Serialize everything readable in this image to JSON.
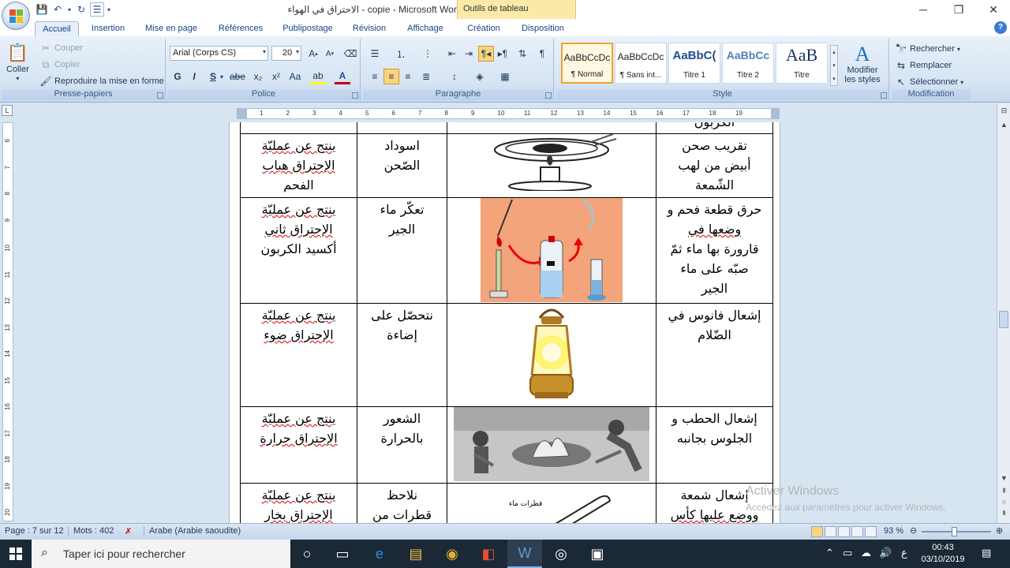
{
  "window": {
    "title": "الاحتراق في الهواء - copie - Microsoft Word",
    "contextual_tab": "Outils de tableau",
    "controls": {
      "minimize": "─",
      "maximize": "❐",
      "close": "✕"
    }
  },
  "tabs": [
    "Accueil",
    "Insertion",
    "Mise en page",
    "Références",
    "Publipostage",
    "Révision",
    "Affichage",
    "Création",
    "Disposition"
  ],
  "ribbon": {
    "clipboard": {
      "label": "Presse-papiers",
      "paste": "Coller",
      "cut": "Couper",
      "copy": "Copier",
      "format_painter": "Reproduire la mise en forme"
    },
    "font": {
      "label": "Police",
      "font_name": "Arial (Corps CS)",
      "font_size": "20",
      "bold": "G",
      "italic": "I",
      "underline": "S",
      "strike": "abe",
      "subscript": "x₂",
      "superscript": "x²",
      "change_case": "Aa",
      "highlight": "ab",
      "color": "A"
    },
    "paragraph": {
      "label": "Paragraphe"
    },
    "styles": {
      "label": "Style",
      "items": [
        {
          "preview": "AaBbCcDc",
          "name": "¶ Normal"
        },
        {
          "preview": "AaBbCcDc",
          "name": "¶ Sans int..."
        },
        {
          "preview": "AaBbC(",
          "name": "Titre 1"
        },
        {
          "preview": "AaBbCc",
          "name": "Titre 2"
        },
        {
          "preview": "AaB",
          "name": "Titre"
        }
      ],
      "change": "Modifier les styles"
    },
    "editing": {
      "label": "Modification",
      "find": "Rechercher",
      "replace": "Remplacer",
      "select": "Sélectionner"
    }
  },
  "ruler": {
    "ticks": [
      "1",
      "2",
      "3",
      "4",
      "5",
      "6",
      "7",
      "8",
      "9",
      "10",
      "11",
      "12",
      "13",
      "14",
      "15",
      "16",
      "17",
      "18",
      "19"
    ],
    "vticks": [
      "6",
      "7",
      "8",
      "9",
      "10",
      "11",
      "12",
      "13",
      "14",
      "15",
      "16",
      "17",
      "18",
      "19",
      "20"
    ]
  },
  "table": {
    "top_fragment": "الكربون",
    "rows": [
      {
        "experiment": [
          "تقريب صحن",
          "أبيض من لهب",
          "الشّمعة"
        ],
        "observation": [
          "اسوداد",
          "الصّحن"
        ],
        "conclusion": [
          "ينتج عن عمليّة",
          "الإحتراق هباب",
          "الفحم"
        ]
      },
      {
        "experiment": [
          "حرق قطعة فحم و",
          "وضعها في",
          "قارورة بها ماء ثمّ",
          "صبّه على ماء",
          "الجير"
        ],
        "observation": [
          "تعكّر ماء",
          "الجير"
        ],
        "conclusion": [
          "ينتج عن عمليّة",
          "الإحتراق ثاني",
          "أكسيد الكربون"
        ]
      },
      {
        "experiment": [
          "إشعال فانوس في",
          "الضّلام"
        ],
        "observation": [
          "نتحصّل على",
          "إضاءة"
        ],
        "conclusion": [
          "ينتج عن عمليّة",
          "الإحتراق ضوء"
        ]
      },
      {
        "experiment": [
          "إشعال الحطب و",
          "الجلوس بجانبه"
        ],
        "observation": [
          "الشعور",
          "بالحرارة"
        ],
        "conclusion": [
          "ينتج عن عمليّة",
          "الإحتراق حرارة"
        ]
      },
      {
        "experiment": [
          "إشعال شمعة",
          "ووضع عليها كأس"
        ],
        "observation": [
          "نلاحظ",
          "قطرات من"
        ],
        "conclusion": [
          "ينتج عن عمليّة",
          "الإحتراق بخار"
        ]
      }
    ],
    "image_caption": "قطرات ماء"
  },
  "watermark": {
    "line1": "Activer Windows",
    "line2": "Accédez aux paramètres pour activer Windows."
  },
  "status": {
    "page": "Page : 7 sur 12",
    "words": "Mots : 402",
    "language": "Arabe (Arabie saoudite)",
    "zoom": "93 %",
    "zoom_value": 93
  },
  "taskbar": {
    "search_placeholder": "Taper ici pour rechercher",
    "time": "00:43",
    "date": "03/10/2019",
    "lang": "ع"
  },
  "colors": {
    "accent": "#2b579a",
    "ribbon_bg": "#d6e4f3",
    "tools_tab": "#fbe9a8",
    "taskbar": "#1b2836"
  }
}
